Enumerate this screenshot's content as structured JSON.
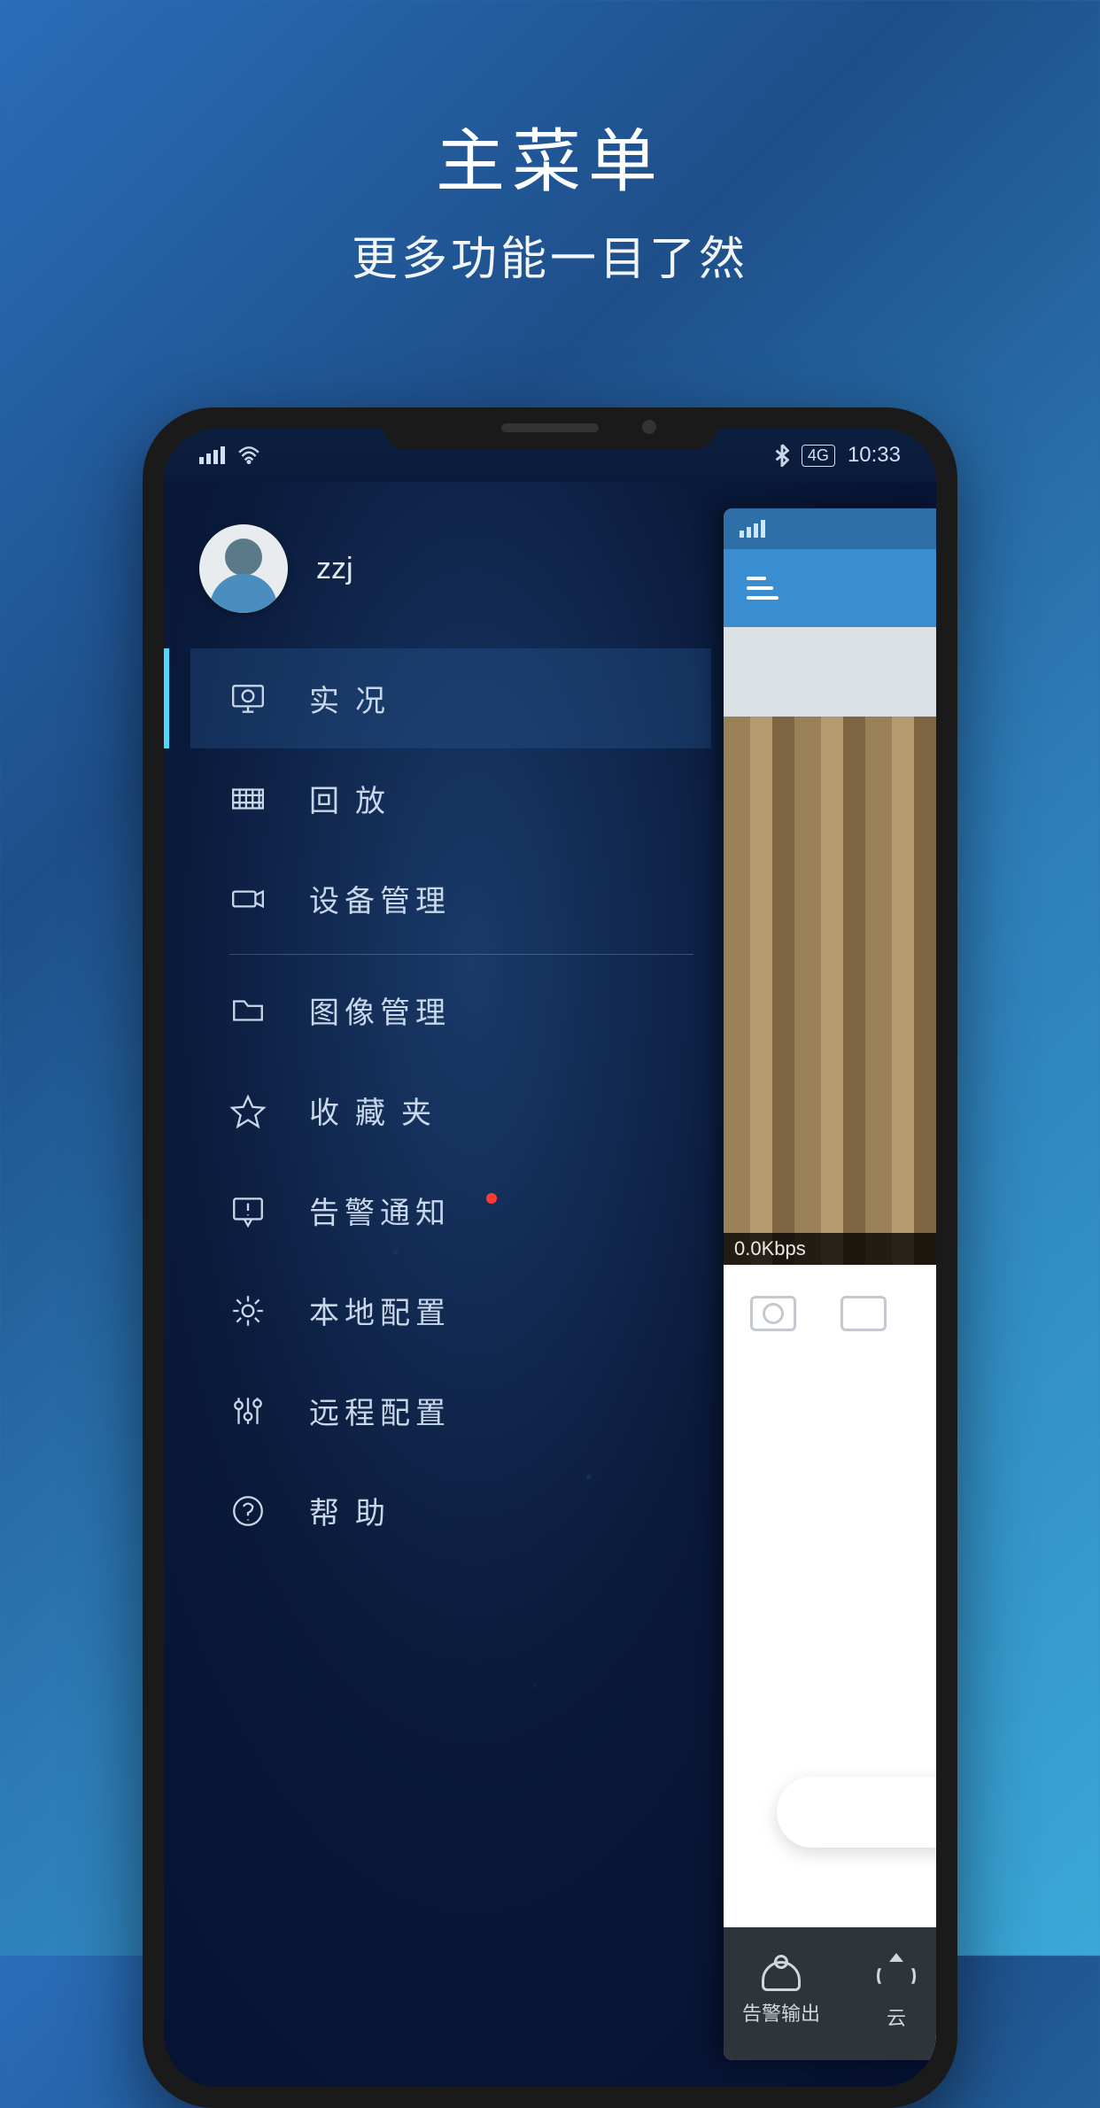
{
  "promo": {
    "title": "主菜单",
    "subtitle": "更多功能一目了然"
  },
  "statusbar": {
    "network_indicator": "4G",
    "time": "10:33"
  },
  "profile": {
    "username": "zzj"
  },
  "menu": {
    "live": "实况",
    "playback": "回放",
    "device_mgmt": "设备管理",
    "image_mgmt": "图像管理",
    "favorites": "收藏夹",
    "alarm_notify": "告警通知",
    "local_config": "本地配置",
    "remote_config": "远程配置",
    "help": "帮助"
  },
  "peek": {
    "kbps": "0.0Kbps",
    "bottom_alarm_output": "告警输出",
    "bottom_ptz_prefix": "云"
  }
}
